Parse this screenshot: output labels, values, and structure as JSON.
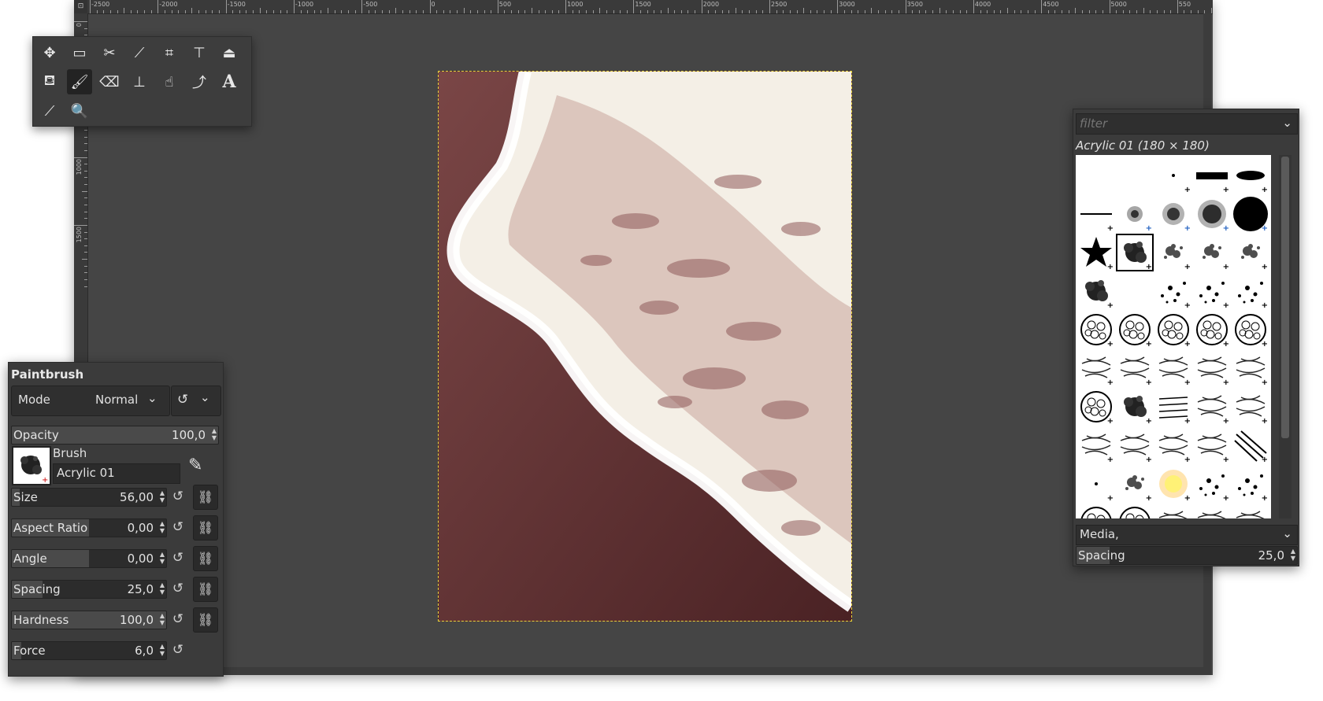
{
  "ruler": {
    "corner": "⊡",
    "h_labels": [
      "-2500",
      "-2000",
      "-1500",
      "-1000",
      "-500",
      "0",
      "500",
      "1000",
      "1500",
      "2000",
      "2500",
      "3000",
      "3500",
      "4000",
      "4500",
      "5000",
      "550"
    ],
    "v_labels": [
      "0",
      "500",
      "1000",
      "1500"
    ]
  },
  "toolbox": {
    "tools": [
      {
        "name": "move-tool",
        "glyph": "✥"
      },
      {
        "name": "rect-select-tool",
        "glyph": "▭"
      },
      {
        "name": "free-select-tool",
        "glyph": "✂"
      },
      {
        "name": "fuzzy-select-tool",
        "glyph": "⟋"
      },
      {
        "name": "crop-tool",
        "glyph": "⌗"
      },
      {
        "name": "unified-transform-tool",
        "glyph": "⊤"
      },
      {
        "name": "warp-transform-tool",
        "glyph": "⏏"
      },
      {
        "name": "bucket-fill-tool",
        "glyph": "⛾"
      },
      {
        "name": "paintbrush-tool",
        "glyph": "🖌"
      },
      {
        "name": "eraser-tool",
        "glyph": "⌫"
      },
      {
        "name": "clone-tool",
        "glyph": "⊥"
      },
      {
        "name": "smudge-tool",
        "glyph": "☝"
      },
      {
        "name": "paths-tool",
        "glyph": "⤴"
      },
      {
        "name": "text-tool",
        "glyph": "A"
      },
      {
        "name": "color-picker-tool",
        "glyph": "⟋"
      },
      {
        "name": "zoom-tool",
        "glyph": "🔍"
      }
    ]
  },
  "tool_options": {
    "title": "Paintbrush",
    "mode_label": "Mode",
    "mode_value": "Normal",
    "brush_label": "Brush",
    "brush_value": "Acrylic 01",
    "sliders": [
      {
        "label": "Opacity",
        "value": "100,0",
        "fraction": 1.0
      },
      {
        "label": "Size",
        "value": "56,00",
        "fraction": 0.05
      },
      {
        "label": "Aspect Ratio",
        "value": "0,00",
        "fraction": 0.5
      },
      {
        "label": "Angle",
        "value": "0,00",
        "fraction": 0.5
      },
      {
        "label": "Spacing",
        "value": "25,0",
        "fraction": 0.2
      },
      {
        "label": "Hardness",
        "value": "100,0",
        "fraction": 1.0
      },
      {
        "label": "Force",
        "value": "6,0",
        "fraction": 0.06
      }
    ]
  },
  "brushes": {
    "filter_placeholder": "filter",
    "selected_brush": "Acrylic 01 (180 × 180)",
    "tag": "Media,",
    "spacing_label": "Spacing",
    "spacing_value": "25,0"
  },
  "colors": {
    "window_bg": "#454545",
    "panel_bg": "#3b3b3b",
    "selection_border": "#e6d23a",
    "image_tone": "#5c2f31"
  }
}
